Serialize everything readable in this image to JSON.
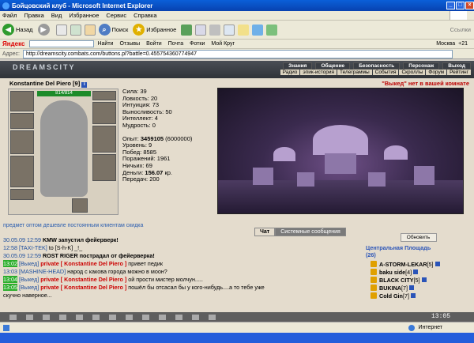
{
  "window": {
    "title": "Бойцовский клуб - Microsoft Internet Explorer"
  },
  "menu": [
    "Файл",
    "Правка",
    "Вид",
    "Избранное",
    "Сервис",
    "Справка"
  ],
  "toolbar": {
    "back": "Назад",
    "search": "Поиск",
    "favorites": "Избранное",
    "links": "Ссылки"
  },
  "yandex": {
    "logo": "Яндекс",
    "find": "Найти",
    "reviews": "Отзывы",
    "login": "Войти",
    "mail": "Почта",
    "photos": "Фотки",
    "my_circle": "Мой Круг",
    "city": "Москва",
    "temp": "+21"
  },
  "address": {
    "label": "Адрес:",
    "url": "http://dreamscity.combats.com/buttons.pl?battle=0.455754360774947"
  },
  "game": {
    "logo": "DREAMSCITY",
    "nav_top": [
      "Знания",
      "Общение",
      "Безопасность",
      "Персонаж",
      "Выход"
    ],
    "nav_sub": [
      "Радио",
      "эпик-история",
      "Телеграммы",
      "События",
      "Скроллы",
      "Форум",
      "Рейтинг"
    ],
    "player": {
      "name": "Konstantine Del Piero",
      "level": "[9]",
      "info": "i",
      "hp": "814/814"
    },
    "room_msg": "\"Выкед\" нет в вашей комнате",
    "stats": {
      "strength": "Сила: 39",
      "agility": "Ловкость: 20",
      "intuition": "Интуиция: 73",
      "endurance": "Выносливость: 50",
      "intellect": "Интеллект: 4",
      "wisdom": "Мудрость: 0",
      "exp_label": "Опыт: ",
      "exp_value": "3459105",
      "exp_next": " (6000000)",
      "level": "Уровень: 9",
      "wins": "Побед: 8585",
      "losses": "Поражений: 1961",
      "draws": "Ничьих: 69",
      "money_label": "Деньги: ",
      "money_value": "156.07",
      "money_unit": " кр.",
      "transfers": "Передач: 200"
    }
  },
  "chat": {
    "ticker": "предмет оптом дешевле постоянным клиентам скидка",
    "tabs": [
      "Чат",
      "Системные сообщения"
    ],
    "lines": [
      {
        "ts": "30.05.09 12:59",
        "text": "KMW запустил фейерверк!"
      },
      {
        "ts": "12:58",
        "user": "[TAXI-TEK]",
        "text": " to [S-h-K] _!_"
      },
      {
        "ts": "30.05.09 12:59",
        "text": "ROST RIGER пострадал от фейерверка!"
      },
      {
        "ts": "13:02",
        "user": "[Выкед]",
        "priv": " private [ Konstantine Del Piero ]",
        "text": " привет педик"
      },
      {
        "ts": "13:03",
        "user": "[MASHINE-HEAD]",
        "text": " народ с какова города можно в моон?"
      },
      {
        "ts": "13:04",
        "user": "[Выкед]",
        "priv": " private [ Konstantine Del Piero ]",
        "text": " ой прости мистер молчун....."
      },
      {
        "ts": "13:05",
        "user": "[Выкед]",
        "priv": " private [ Konstantine Del Piero ]",
        "text": " пошёл бы отсасал бы у кого-нибудь....а то тебе уже"
      },
      {
        "ts": "",
        "text": "скучно наверное..."
      }
    ]
  },
  "side": {
    "refresh": "Обновить",
    "location": "Центральная Площадь",
    "count": "(26)",
    "players": [
      {
        "name": "A-STORM-LEKAR",
        "level": "[5]"
      },
      {
        "name": "baku side",
        "level": "[4]"
      },
      {
        "name": "BLACK CITY",
        "level": "[5]"
      },
      {
        "name": "BUKINA",
        "level": "[7]"
      },
      {
        "name": "Cold Gin",
        "level": "[7]"
      }
    ]
  },
  "clock": "13:05",
  "status": {
    "zone": "Интернет"
  }
}
